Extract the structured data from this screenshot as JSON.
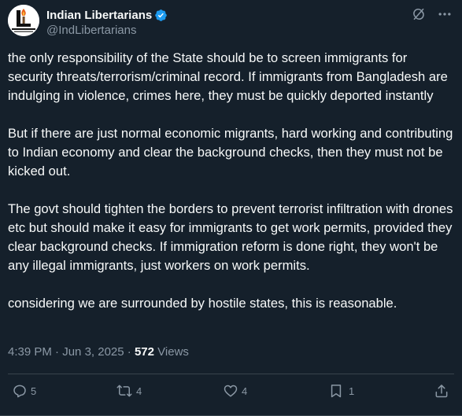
{
  "account": {
    "display_name": "Indian Libertarians",
    "handle": "@IndLibertarians",
    "verified_badge_color": "#1d9bf0",
    "avatar_icon": "libertarian-torch-logo"
  },
  "header_actions": {
    "grok_icon": "grok-icon",
    "more_icon": "more-horizontal-icon"
  },
  "tweet": {
    "paragraphs": [
      "the only responsibility of the State should be to screen immigrants for security threats/terrorism/criminal record. If immigrants from Bangladesh are indulging in violence, crimes here, they must be quickly deported instantly",
      "But if there are just normal economic migrants, hard working and contributing to Indian economy and clear the background checks, then they must not be kicked out.",
      "The govt should tighten the borders to prevent terrorist infiltration with drones etc but should make it easy for immigrants to get work permits, provided they clear background checks. If immigration reform is done right, they won't be any illegal immigrants, just workers on work permits.",
      "considering we are surrounded by hostile states, this is reasonable."
    ]
  },
  "meta": {
    "time": "4:39 PM",
    "separator": " · ",
    "date": "Jun 3, 2025",
    "dot": " · ",
    "views_count": "572",
    "views_label": " Views"
  },
  "actions": {
    "replies": "5",
    "reposts": "4",
    "likes": "4",
    "bookmarks": "1"
  },
  "colors": {
    "background": "#15202b",
    "text": "#f7f9f9",
    "secondary": "#8b98a5",
    "divider": "#38444d"
  }
}
